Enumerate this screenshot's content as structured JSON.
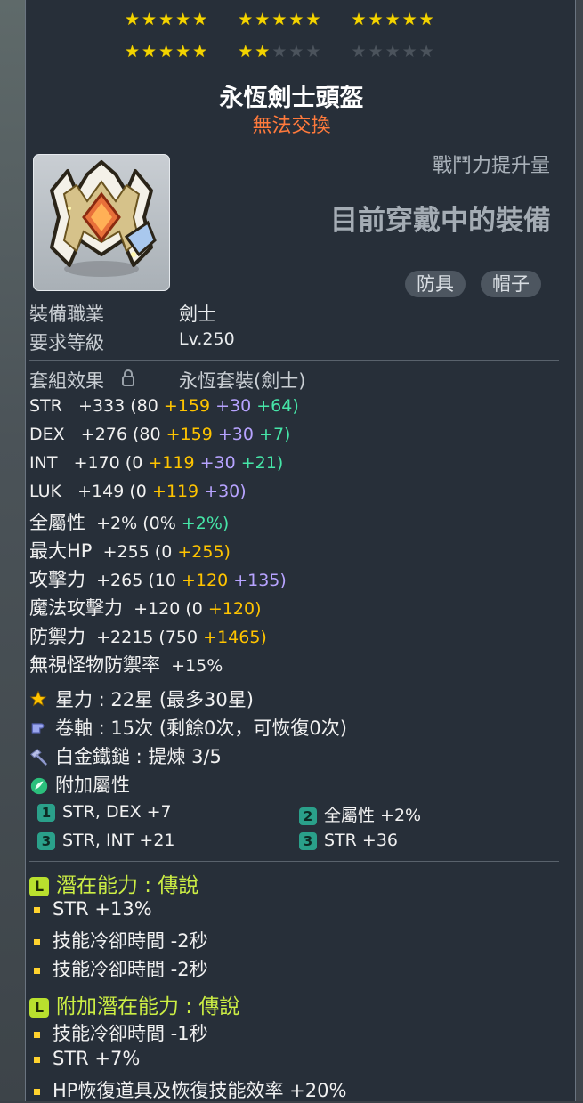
{
  "stars": {
    "filled": 22,
    "total": 30,
    "rows": [
      [
        "★★★★★",
        "★★★★★",
        "★★★★★"
      ],
      [
        "★★★★★",
        "★★",
        "★★★",
        "★★★★★"
      ]
    ]
  },
  "item": {
    "name": "永恆劍士頭盔",
    "trade_status": "無法交換",
    "cp_label": "戰鬥力提升量",
    "equipped_label": "目前穿戴中的裝備",
    "tags": [
      "防具",
      "帽子"
    ],
    "job_label": "裝備職業",
    "job_value": "劍士",
    "level_label": "要求等級",
    "level_value": "Lv.250"
  },
  "set": {
    "label": "套組效果",
    "value": "永恆套裝(劍士)"
  },
  "stats": {
    "str": {
      "name": "STR",
      "total": "+333",
      "base": "(80",
      "star": "+159",
      "enh": "+30",
      "bonus": "+64)"
    },
    "dex": {
      "name": "DEX",
      "total": "+276",
      "base": "(80",
      "star": "+159",
      "enh": "+30",
      "bonus": "+7)"
    },
    "int": {
      "name": "INT",
      "total": "+170",
      "base": "(0",
      "star": "+119",
      "enh": "+30",
      "bonus": "+21)"
    },
    "luk": {
      "name": "LUK",
      "total": "+149",
      "base": "(0",
      "star": "+119",
      "enh": "+30)"
    },
    "allstat": {
      "name": "全屬性",
      "total": "+2%",
      "base": "(0%",
      "bonus": "+2%)"
    },
    "hp": {
      "name": "最大HP",
      "total": "+255",
      "base": "(0",
      "star": "+255)"
    },
    "att": {
      "name": "攻擊力",
      "total": "+265",
      "base": "(10",
      "star": "+120",
      "enh": "+135)"
    },
    "matt": {
      "name": "魔法攻擊力",
      "total": "+120",
      "base": "(0",
      "star": "+120)"
    },
    "def": {
      "name": "防禦力",
      "total": "+2215",
      "base": "(750",
      "star": "+1465)"
    },
    "ied": {
      "name": "無視怪物防禦率",
      "total": "+15%"
    }
  },
  "enhance": {
    "starforce": "星力 : 22星 (最多30星)",
    "scroll": "卷軸 : 15次 (剩餘0次，可恢復0次)",
    "hammer": "白金鐵鎚 : 提煉 3/5",
    "flame_label": "附加屬性"
  },
  "flames": [
    {
      "rank": "1",
      "text": "STR, DEX  +7"
    },
    {
      "rank": "2",
      "text": "全屬性 +2%"
    },
    {
      "rank": "3",
      "text": "STR, INT  +21"
    },
    {
      "rank": "3",
      "text": "STR  +36"
    }
  ],
  "potential": {
    "title": "潛在能力 : 傳說",
    "lines": [
      "STR +13%",
      "技能冷卻時間 -2秒",
      "技能冷卻時間 -2秒"
    ]
  },
  "bonus_potential": {
    "title": "附加潛在能力 : 傳說",
    "lines": [
      "技能冷卻時間 -1秒",
      "STR +7%",
      "HP恢復道具及恢復技能效率 +20%"
    ]
  },
  "colors": {
    "star_on": "#f3d400",
    "untradable": "#ff7a3c",
    "starforce_bonus": "#ffc400",
    "enhance_bonus": "#b7a3ff",
    "flame_bonus": "#46e6a8",
    "legendary": "#ccee44"
  },
  "icons": {
    "item": "helmet-icon",
    "lock": "lock-icon",
    "star": "star-icon",
    "scroll": "scroll-icon",
    "hammer": "hammer-icon",
    "flame": "flame-icon"
  }
}
